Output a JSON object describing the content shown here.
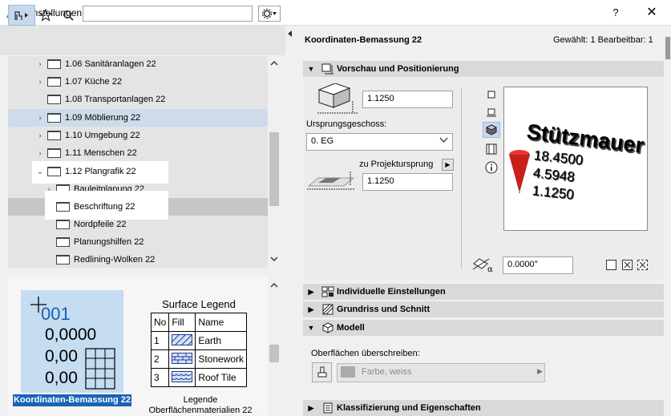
{
  "window": {
    "title": "Einstellungen für die Objekt-Auswahl",
    "help": "?",
    "close": "✕"
  },
  "toolbar": {
    "search_placeholder": ""
  },
  "tree": {
    "items": [
      {
        "label": "1.06 Sanitäranlagen 22",
        "arrow": "›"
      },
      {
        "label": "1.07 Küche 22",
        "arrow": "›"
      },
      {
        "label": "1.08 Transportanlagen 22",
        "arrow": ""
      },
      {
        "label": "1.09 Möblierung 22",
        "arrow": "›"
      },
      {
        "label": "1.10 Umgebung 22",
        "arrow": "›"
      },
      {
        "label": "1.11 Menschen 22",
        "arrow": "›"
      },
      {
        "label": "1.12 Plangrafik 22",
        "arrow": "⌄"
      },
      {
        "label": "Bauleitplanung 22",
        "arrow": "›"
      },
      {
        "label": "Beschriftung 22",
        "arrow": ""
      },
      {
        "label": "Nordpfeile 22",
        "arrow": ""
      },
      {
        "label": "Planungshilfen 22",
        "arrow": ""
      },
      {
        "label": "Redlining-Wolken 22",
        "arrow": ""
      }
    ]
  },
  "preview": {
    "tile_caption": "Koordinaten-Bemassung 22",
    "tile_lines": [
      "001",
      "0,0000",
      "0,00",
      "0,00"
    ],
    "legend_title": "Surface Legend",
    "legend_headers": [
      "No",
      "Fill",
      "Name"
    ],
    "legend_rows": [
      {
        "no": "1",
        "name": "Earth"
      },
      {
        "no": "2",
        "name": "Stonework"
      },
      {
        "no": "3",
        "name": "Roof Tile"
      }
    ],
    "legend_caption_1": "Legende",
    "legend_caption_2": "Oberflächenmaterialien 22"
  },
  "right": {
    "title": "Koordinaten-Bemassung 22",
    "status": "Gewählt: 1 Bearbeitbar: 1",
    "sections": {
      "vorschau": "Vorschau und Positionierung",
      "individuell": "Individuelle Einstellungen",
      "grundriss": "Grundriss und Schnitt",
      "modell": "Modell",
      "klassifizierung": "Klassifizierung und Eigenschaften"
    },
    "height_value": "1.1250",
    "storey_label": "Ursprungsgeschoss:",
    "storey_value": "0. EG",
    "proj_label": "zu Projektursprung",
    "proj_value": "1.1250",
    "angle_value": "0.0000°",
    "preview3d": {
      "title": "Stützmauer",
      "lines": [
        "18.4500",
        "4.5948",
        "1.1250"
      ]
    },
    "ober_label": "Oberflächen überschreiben:",
    "surface_value": "Farbe, weiss"
  },
  "colors": {
    "accent": "#1b63b6",
    "tile": "#c5dcf1",
    "cone": "#c8201a"
  }
}
